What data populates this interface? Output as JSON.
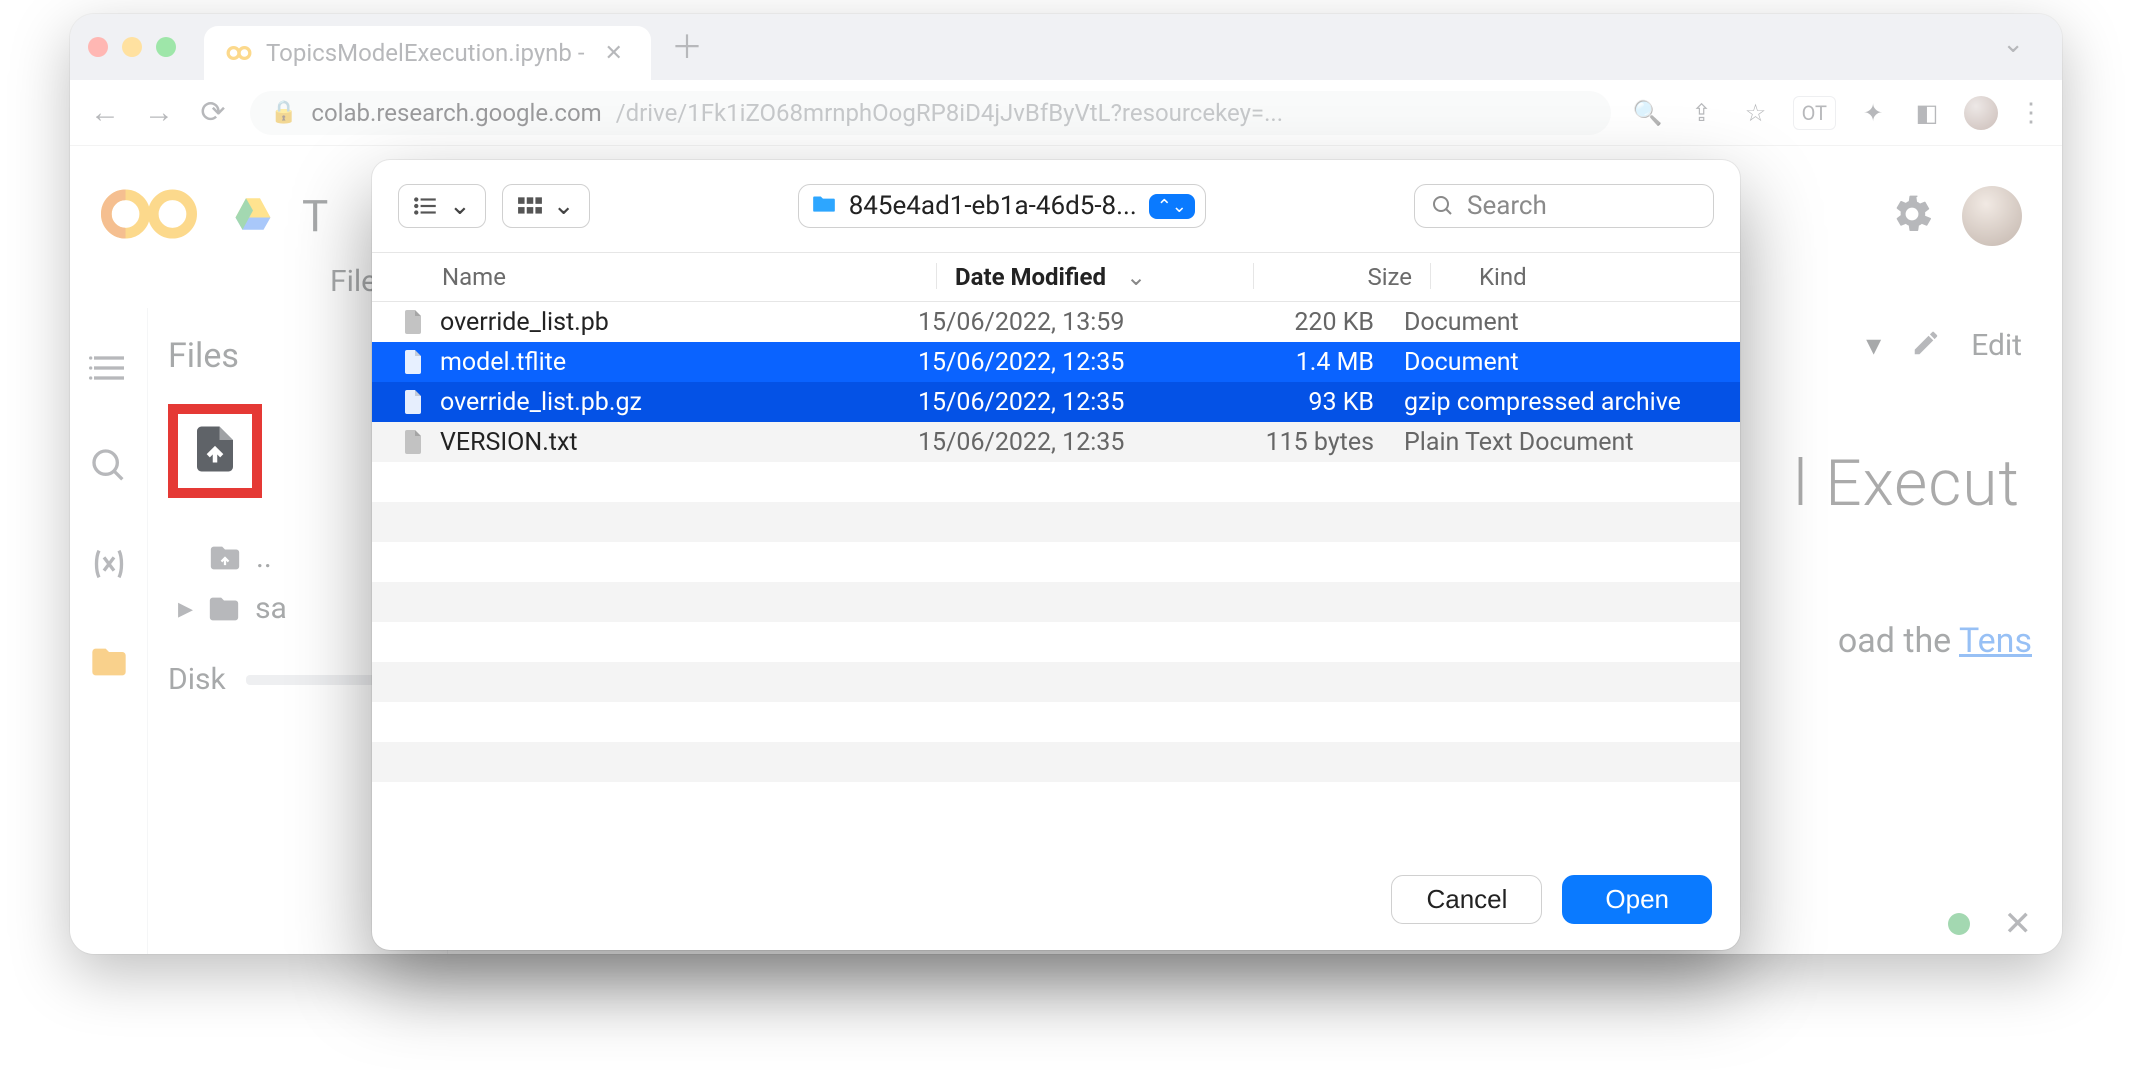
{
  "browser": {
    "tab_title": "TopicsModelExecution.ipynb -",
    "url_host": "colab.research.google.com",
    "url_path": "/drive/1Fk1iZO68mrnphOogRP8iD4jJvBfByVtL?resourcekey=...",
    "profile_initials": "OT"
  },
  "colab": {
    "title_fragment": "T",
    "menu_file": "File",
    "files_pane_title": "Files",
    "tree_parent": "..",
    "tree_sample": "sa",
    "disk_label": "Disk",
    "nb_edit": "Edit",
    "nb_heading": "l Execut",
    "nb_paragraph_prefix": "oad the ",
    "nb_link_text": "Tens"
  },
  "file_dialog": {
    "folder_name": "845e4ad1-eb1a-46d5-8...",
    "search_placeholder": "Search",
    "columns": {
      "name": "Name",
      "date": "Date Modified",
      "size": "Size",
      "kind": "Kind"
    },
    "rows": [
      {
        "name": "override_list.pb",
        "date": "15/06/2022, 13:59",
        "size": "220 KB",
        "kind": "Document",
        "selected": false
      },
      {
        "name": "model.tflite",
        "date": "15/06/2022, 12:35",
        "size": "1.4 MB",
        "kind": "Document",
        "selected": true
      },
      {
        "name": "override_list.pb.gz",
        "date": "15/06/2022, 12:35",
        "size": "93 KB",
        "kind": "gzip compressed archive",
        "selected": true
      },
      {
        "name": "VERSION.txt",
        "date": "15/06/2022, 12:35",
        "size": "115 bytes",
        "kind": "Plain Text Document",
        "selected": false
      }
    ],
    "cancel": "Cancel",
    "open": "Open"
  }
}
